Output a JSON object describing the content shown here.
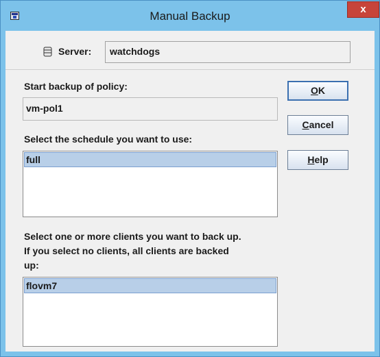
{
  "window": {
    "title": "Manual Backup",
    "close_label": "x"
  },
  "server": {
    "label": "Server:",
    "value": "watchdogs",
    "icon": "database-icon"
  },
  "policy": {
    "label": "Start backup of policy:",
    "value": "vm-pol1"
  },
  "schedule": {
    "label": "Select the schedule you want to use:",
    "items": [
      "full"
    ],
    "selected": "full"
  },
  "clients": {
    "label_lines": [
      "Select one or more clients you want to back up.",
      "If you select no clients, all clients are backed",
      "up:"
    ],
    "items": [
      "flovm7"
    ],
    "selected": "flovm7"
  },
  "buttons": {
    "ok": {
      "mnemonic": "O",
      "rest": "K"
    },
    "cancel": {
      "mnemonic": "C",
      "rest": "ancel"
    },
    "help": {
      "mnemonic": "H",
      "rest": "elp"
    }
  },
  "colors": {
    "titlebar": "#7cc2ea",
    "close": "#c7443a",
    "selection": "#b8cfe8"
  }
}
